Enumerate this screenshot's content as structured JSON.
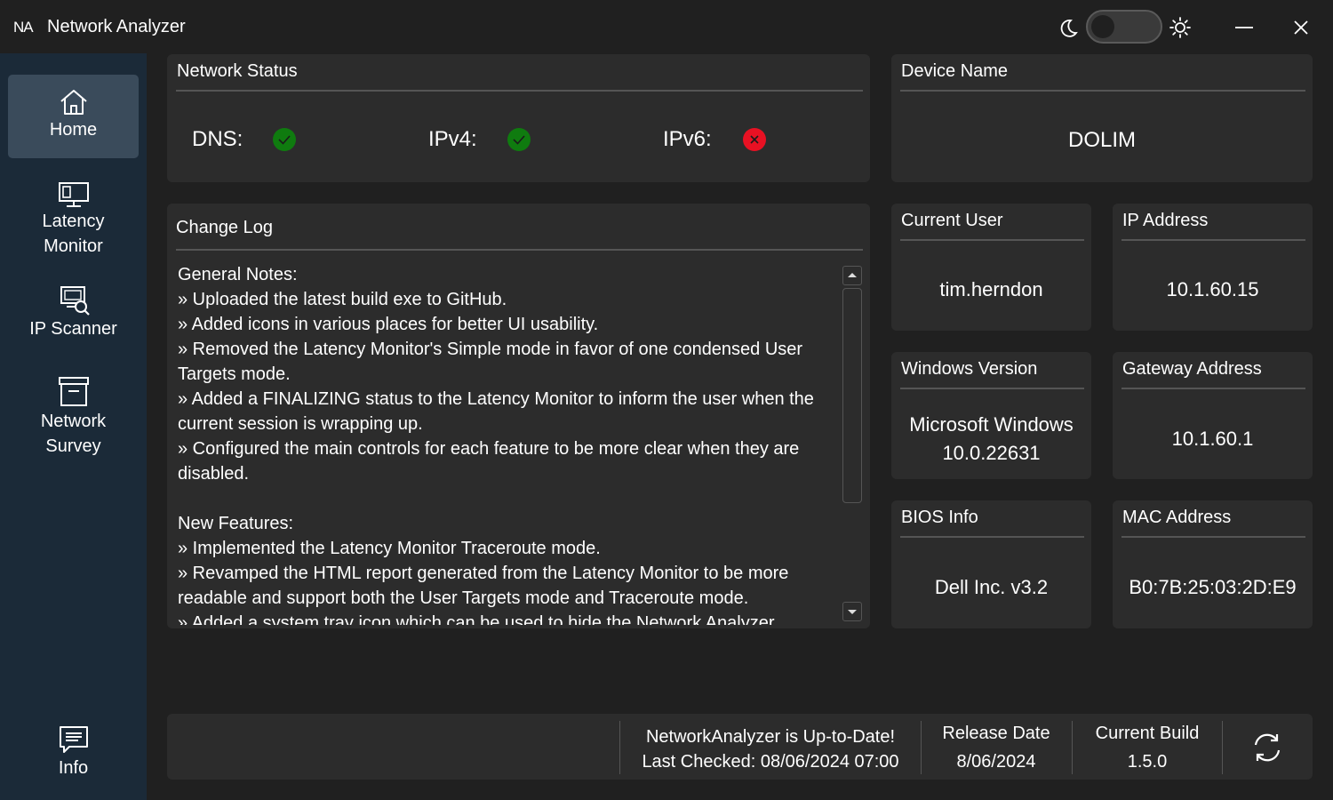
{
  "app": {
    "logo": "NA",
    "title": "Network Analyzer"
  },
  "sidebar": {
    "items": [
      {
        "label": "Home",
        "icon": "home-icon"
      },
      {
        "label": "Latency Monitor",
        "line1": "Latency",
        "line2": "Monitor",
        "icon": "monitor-icon"
      },
      {
        "label": "IP Scanner",
        "icon": "ip-scanner-icon"
      },
      {
        "label": "Network Survey",
        "line1": "Network",
        "line2": "Survey",
        "icon": "survey-icon"
      },
      {
        "label": "Info",
        "icon": "info-icon"
      }
    ]
  },
  "network_status": {
    "title": "Network Status",
    "items": [
      {
        "label": "DNS:",
        "status": "ok"
      },
      {
        "label": "IPv4:",
        "status": "ok"
      },
      {
        "label": "IPv6:",
        "status": "error"
      }
    ]
  },
  "change_log": {
    "title": "Change Log",
    "lines": [
      "General Notes:",
      "» Uploaded the latest build exe to GitHub.",
      "» Added icons in various places for better UI usability.",
      "» Removed the Latency Monitor's Simple mode in favor of one condensed User Targets mode.",
      "» Added a FINALIZING status to the Latency Monitor to inform the user when the current session is wrapping up.",
      "» Configured the main controls for each feature to be more clear when they are disabled.",
      "",
      "New Features:",
      "» Implemented the Latency Monitor Traceroute mode.",
      "» Revamped the HTML report generated from the Latency Monitor to be more readable and support both the User Targets mode and Traceroute mode.",
      "» Added a system tray icon which can be used to hide the Network Analyzer"
    ]
  },
  "device_name": {
    "title": "Device Name",
    "value": "DOLIM"
  },
  "current_user": {
    "title": "Current User",
    "value": "tim.herndon"
  },
  "ip_address": {
    "title": "IP Address",
    "value": "10.1.60.15"
  },
  "windows_version": {
    "title": "Windows Version",
    "line1": "Microsoft Windows",
    "line2": "10.0.22631"
  },
  "gateway_address": {
    "title": "Gateway Address",
    "value": "10.1.60.1"
  },
  "bios_info": {
    "title": "BIOS Info",
    "value": "Dell Inc. v3.2"
  },
  "mac_address": {
    "title": "MAC Address",
    "value": "B0:7B:25:03:2D:E9"
  },
  "footer": {
    "update_status": "NetworkAnalyzer is Up-to-Date!",
    "last_checked": "Last Checked: 08/06/2024 07:00",
    "release_date_label": "Release Date",
    "release_date": "8/06/2024",
    "current_build_label": "Current Build",
    "current_build": "1.5.0"
  },
  "colors": {
    "ok": "#0f7b0f",
    "error": "#e81123",
    "sidebar": "#1b2a38",
    "panel": "#2c2c2c",
    "background": "#202020"
  }
}
